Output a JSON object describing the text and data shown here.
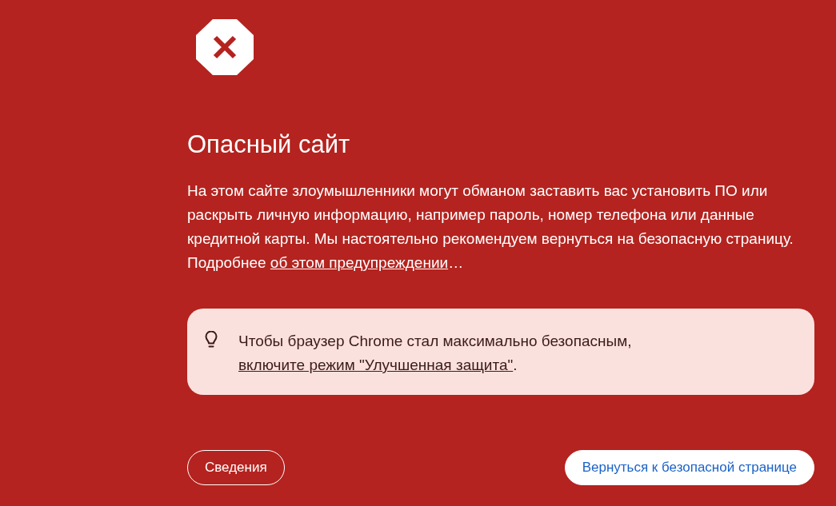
{
  "warning": {
    "title": "Опасный сайт",
    "message": {
      "text": "На этом сайте злоумышленники могут обманом заставить вас установить ПО или раскрыть личную информацию, например пароль, номер телефона или данные кредитной карты. Мы настоятельно рекомендуем вернуться на безопасную страницу. Подробнее ",
      "link": "об этом предупреждении",
      "after": "…"
    }
  },
  "tip": {
    "text": "Чтобы браузер Chrome стал максимально безопасным, ",
    "link": "включите режим \"Улучшенная защита\"",
    "after": "."
  },
  "buttons": [
    {
      "label": "Сведения",
      "kind": "secondary"
    },
    {
      "label": "Вернуться к безопасной странице",
      "kind": "primary"
    }
  ]
}
